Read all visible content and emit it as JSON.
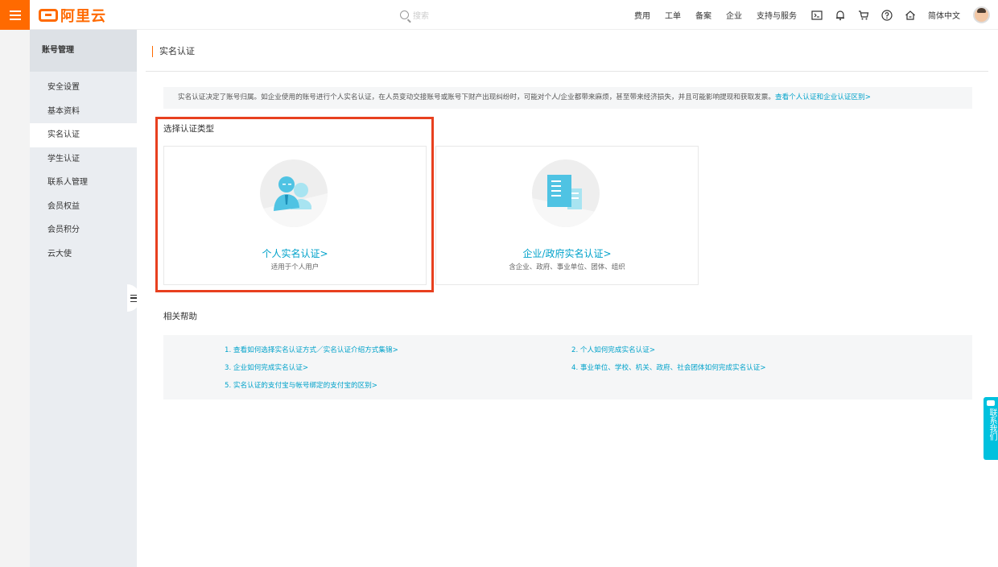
{
  "header": {
    "logo_text": "阿里云",
    "search_placeholder": "搜索",
    "nav_links": [
      "费用",
      "工单",
      "备案",
      "企业",
      "支持与服务"
    ],
    "icons": [
      "terminal-icon",
      "bell-icon",
      "cart-icon",
      "help-icon",
      "home-icon"
    ],
    "language": "简体中文"
  },
  "sidebar": {
    "title": "账号管理",
    "items": [
      {
        "label": "安全设置"
      },
      {
        "label": "基本资料"
      },
      {
        "label": "实名认证"
      },
      {
        "label": "学生认证"
      },
      {
        "label": "联系人管理"
      },
      {
        "label": "会员权益"
      },
      {
        "label": "会员积分"
      },
      {
        "label": "云大使"
      }
    ],
    "active_index": 2
  },
  "page": {
    "title": "实名认证",
    "notice": "实名认证决定了账号归属。如企业使用的账号进行个人实名认证，在人员变动交接账号或账号下财产出现纠纷时，可能对个人/企业都带来麻烦，甚至带来经济损失，并且可能影响提现和获取发票。",
    "notice_link": "查看个人认证和企业认证区别>",
    "type_section_label": "选择认证类型",
    "cards": [
      {
        "title": "个人实名认证>",
        "subtitle": "适用于个人用户"
      },
      {
        "title": "企业/政府实名认证>",
        "subtitle": "含企业、政府、事业单位、团体、组织"
      }
    ],
    "help_section_label": "相关帮助",
    "help_links": [
      "1. 查看如何选择实名认证方式／实名认证介绍方式集锦>",
      "2. 个人如何完成实名认证>",
      "3. 企业如何完成实名认证>",
      "4. 事业单位、学校、机关、政府、社会团体如何完成实名认证>",
      "5. 实名认证的支付宝与帐号绑定的支付宝的区别>"
    ]
  },
  "contact": {
    "label": "联系我们"
  },
  "colors": {
    "brand": "#ff6a00",
    "link": "#00a2ca",
    "highlight": "#e8401f",
    "contact": "#00c1de"
  }
}
